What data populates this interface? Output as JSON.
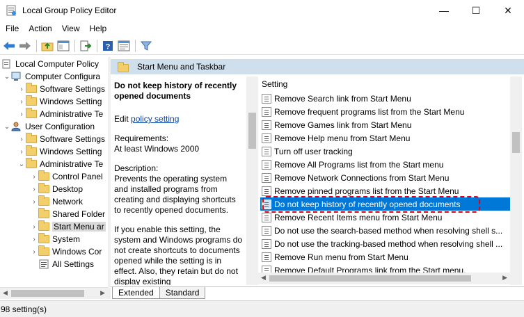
{
  "window": {
    "title": "Local Group Policy Editor",
    "minimize": "—",
    "maximize": "☐",
    "close": "✕"
  },
  "menu": [
    "File",
    "Action",
    "View",
    "Help"
  ],
  "toolbar": [
    "back-icon",
    "forward-icon",
    "up-folder-icon",
    "show-hide-tree-icon",
    "export-list-icon",
    "help-icon",
    "properties-icon",
    "filter-icon"
  ],
  "tree": {
    "items": [
      {
        "label": "Local Computer Policy",
        "expander": ""
      },
      {
        "label": "Computer Configura",
        "expander": "⌄"
      },
      {
        "label": "Software Settings",
        "expander": "›"
      },
      {
        "label": "Windows Setting",
        "expander": "›"
      },
      {
        "label": "Administrative Te",
        "expander": "›"
      },
      {
        "label": "User Configuration",
        "expander": "⌄"
      },
      {
        "label": "Software Settings",
        "expander": "›"
      },
      {
        "label": "Windows Setting",
        "expander": "›"
      },
      {
        "label": "Administrative Te",
        "expander": "⌄"
      },
      {
        "label": "Control Panel",
        "expander": "›"
      },
      {
        "label": "Desktop",
        "expander": "›"
      },
      {
        "label": "Network",
        "expander": "›"
      },
      {
        "label": "Shared Folder",
        "expander": ""
      },
      {
        "label": "Start Menu ar",
        "expander": "›"
      },
      {
        "label": "System",
        "expander": "›"
      },
      {
        "label": "Windows Cor",
        "expander": "›"
      },
      {
        "label": "All Settings",
        "expander": ""
      }
    ]
  },
  "pane": {
    "header": "Start Menu and Taskbar",
    "description": {
      "title": "Do not keep history of recently opened documents",
      "edit_prefix": "Edit ",
      "edit_link": "policy setting",
      "requirements_label": "Requirements:",
      "requirements_value": "At least Windows 2000",
      "description_label": "Description:",
      "description_text": "Prevents the operating system and installed programs from creating and displaying shortcuts to recently opened documents.",
      "description_more": "If you enable this setting, the system and Windows programs do not create shortcuts to documents opened while the setting is in effect. Also, they retain but do not display existing"
    },
    "list_header": "Setting",
    "settings": [
      "Remove Search link from Start Menu",
      "Remove frequent programs list from the Start Menu",
      "Remove Games link from Start Menu",
      "Remove Help menu from Start Menu",
      "Turn off user tracking",
      "Remove All Programs list from the Start menu",
      "Remove Network Connections from Start Menu",
      "Remove pinned programs list from the Start Menu",
      "Do not keep history of recently opened documents",
      "Remove Recent Items menu from Start Menu",
      "Do not use the search-based method when resolving shell s...",
      "Do not use the tracking-based method when resolving shell ...",
      "Remove Run menu from Start Menu",
      "Remove Default Programs link from the Start menu."
    ],
    "selected_index": 8,
    "tabs": [
      "Extended",
      "Standard"
    ]
  },
  "status": "98 setting(s)",
  "colors": {
    "selection": "#0078d7",
    "header_band": "#cfdfec",
    "annotation": "#e0001a"
  }
}
